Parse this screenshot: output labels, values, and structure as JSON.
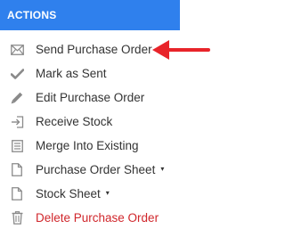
{
  "header": {
    "title": "ACTIONS"
  },
  "menu": {
    "items": [
      {
        "label": "Send Purchase Order",
        "icon": "envelope-icon"
      },
      {
        "label": "Mark as Sent",
        "icon": "checkmark-icon"
      },
      {
        "label": "Edit Purchase Order",
        "icon": "pencil-icon"
      },
      {
        "label": "Receive Stock",
        "icon": "sign-in-icon"
      },
      {
        "label": "Merge Into Existing",
        "icon": "list-document-icon"
      },
      {
        "label": "Purchase Order Sheet",
        "icon": "document-icon",
        "caret": "▾"
      },
      {
        "label": "Stock Sheet",
        "icon": "document-icon",
        "caret": "▾"
      },
      {
        "label": "Delete Purchase Order",
        "icon": "trash-icon"
      }
    ]
  },
  "colors": {
    "header_bg": "#2f80ed",
    "header_text": "#ffffff",
    "item_text": "#333333",
    "icon": "#8a8a8a",
    "danger": "#d0262b",
    "arrow": "#e8242a"
  }
}
